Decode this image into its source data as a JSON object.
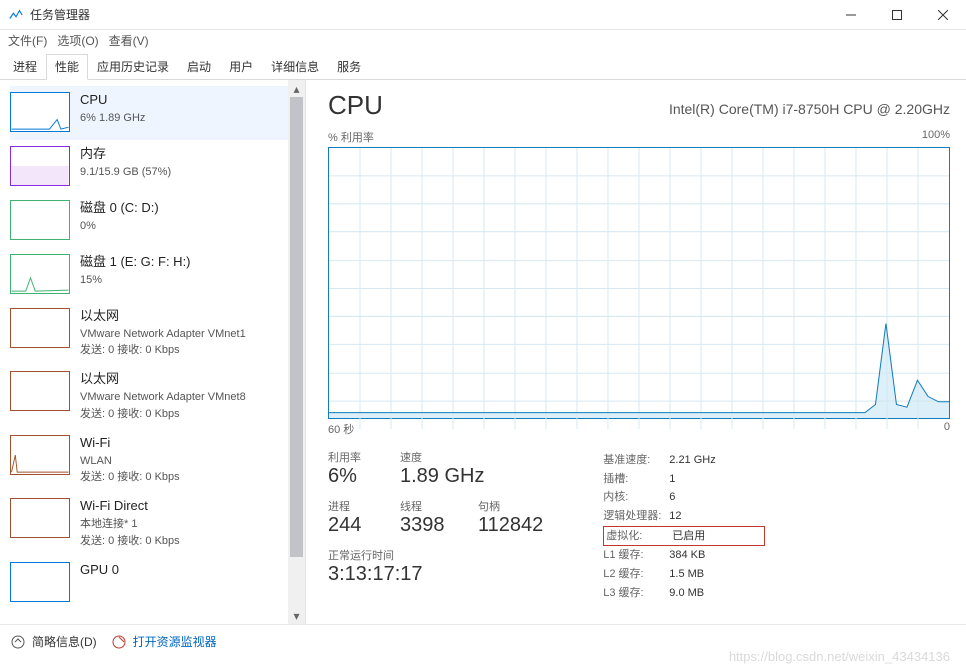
{
  "window": {
    "title": "任务管理器"
  },
  "menu": {
    "file": "文件(F)",
    "options": "选项(O)",
    "view": "查看(V)"
  },
  "tabs": [
    "进程",
    "性能",
    "应用历史记录",
    "启动",
    "用户",
    "详细信息",
    "服务"
  ],
  "sidebar": {
    "cpu": {
      "title": "CPU",
      "sub": "6%  1.89 GHz"
    },
    "mem": {
      "title": "内存",
      "sub": "9.1/15.9 GB (57%)"
    },
    "disk0": {
      "title": "磁盘 0 (C: D:)",
      "sub": "0%"
    },
    "disk1": {
      "title": "磁盘 1 (E: G: F: H:)",
      "sub": "15%"
    },
    "eth0": {
      "title": "以太网",
      "sub1": "VMware Network Adapter VMnet1",
      "sub2": "发送: 0 接收: 0 Kbps"
    },
    "eth1": {
      "title": "以太网",
      "sub1": "VMware Network Adapter VMnet8",
      "sub2": "发送: 0 接收: 0 Kbps"
    },
    "wifi": {
      "title": "Wi-Fi",
      "sub1": "WLAN",
      "sub2": "发送: 0 接收: 0 Kbps"
    },
    "wifid": {
      "title": "Wi-Fi Direct",
      "sub1": "本地连接* 1",
      "sub2": "发送: 0 接收: 0 Kbps"
    },
    "gpu": {
      "title": "GPU 0"
    }
  },
  "main": {
    "title": "CPU",
    "model": "Intel(R) Core(TM) i7-8750H CPU @ 2.20GHz",
    "chart_label_left": "% 利用率",
    "chart_label_right": "100%",
    "axis_left": "60 秒",
    "axis_right": "0",
    "stats": {
      "util": {
        "label": "利用率",
        "value": "6%"
      },
      "speed": {
        "label": "速度",
        "value": "1.89 GHz"
      },
      "proc": {
        "label": "进程",
        "value": "244"
      },
      "threads": {
        "label": "线程",
        "value": "3398"
      },
      "handles": {
        "label": "句柄",
        "value": "112842"
      },
      "uptime": {
        "label": "正常运行时间",
        "value": "3:13:17:17"
      }
    },
    "specs": {
      "base": {
        "label": "基准速度:",
        "value": "2.21 GHz"
      },
      "sockets": {
        "label": "插槽:",
        "value": "1"
      },
      "cores": {
        "label": "内核:",
        "value": "6"
      },
      "logical": {
        "label": "逻辑处理器:",
        "value": "12"
      },
      "virt": {
        "label": "虚拟化:",
        "value": "已启用"
      },
      "l1": {
        "label": "L1 缓存:",
        "value": "384 KB"
      },
      "l2": {
        "label": "L2 缓存:",
        "value": "1.5 MB"
      },
      "l3": {
        "label": "L3 缓存:",
        "value": "9.0 MB"
      }
    }
  },
  "chart_data": {
    "type": "area",
    "title": "CPU 利用率",
    "ylabel": "% 利用率",
    "ylim": [
      0,
      100
    ],
    "xlim_seconds": [
      60,
      0
    ],
    "values_percent": [
      2,
      2,
      2,
      2,
      2,
      2,
      2,
      2,
      2,
      2,
      2,
      2,
      2,
      2,
      2,
      2,
      2,
      2,
      2,
      2,
      2,
      2,
      2,
      2,
      2,
      2,
      2,
      2,
      2,
      2,
      2,
      2,
      2,
      2,
      2,
      2,
      2,
      2,
      2,
      2,
      2,
      2,
      2,
      2,
      2,
      2,
      2,
      2,
      2,
      2,
      2,
      2,
      5,
      35,
      5,
      4,
      14,
      8,
      6,
      6
    ]
  },
  "footer": {
    "brief": "简略信息(D)",
    "resmon": "打开资源监视器"
  },
  "watermark": "https://blog.csdn.net/weixin_43434136"
}
